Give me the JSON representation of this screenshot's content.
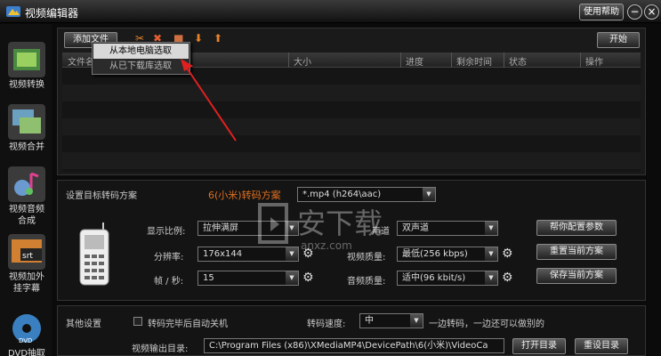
{
  "titlebar": {
    "title": "视频编辑器",
    "help": "使用帮助",
    "min": "−",
    "close": "×"
  },
  "sidebar": {
    "items": [
      {
        "label": "视频转换"
      },
      {
        "label": "视频合并"
      },
      {
        "label": "视频音频合成"
      },
      {
        "label": "视频加外挂字幕"
      },
      {
        "label": "DVD抽取"
      }
    ]
  },
  "toolbar": {
    "add_file": "添加文件",
    "start": "开始"
  },
  "add_menu": {
    "local": "从本地电脑选取",
    "downloaded": "从已下载库选取"
  },
  "table": {
    "columns": [
      "文件名",
      "大小",
      "进度",
      "剩余时间",
      "状态",
      "操作"
    ]
  },
  "scheme": {
    "label": "设置目标转码方案",
    "device": "6(小米)转码方案",
    "format": "*.mp4 (h264\\aac)"
  },
  "settings": {
    "ratio_label": "显示比例:",
    "ratio_value": "拉伸满屏",
    "resolution_label": "分辨率:",
    "resolution_value": "176x144",
    "fps_label": "帧 / 秒:",
    "fps_value": "15",
    "channel_label": "声道",
    "channel_value": "双声道",
    "video_quality_label": "视频质量:",
    "video_quality_value": "最低(256 kbps)",
    "audio_quality_label": "音频质量:",
    "audio_quality_value": "适中(96 kbit/s)"
  },
  "actions": {
    "help_config": "帮你配置参数",
    "reset_scheme": "重置当前方案",
    "save_scheme": "保存当前方案"
  },
  "other": {
    "label": "其他设置",
    "shutdown": "转码完毕后自动关机",
    "speed_label": "转码速度:",
    "speed_value": "中",
    "speed_hint": "一边转码，一边还可以做别的",
    "output_label": "视频输出目录:",
    "output_path": "C:\\Program Files (x86)\\XMediaMP4\\DevicePath\\6(小米)\\VideoCa",
    "open_dir": "打开目录",
    "reset_dir": "重设目录"
  },
  "watermark": {
    "text": "安下载",
    "sub": "anxz.com"
  },
  "colors": {
    "accent_orange": "#e07020",
    "arrow_red": "#e02020"
  }
}
